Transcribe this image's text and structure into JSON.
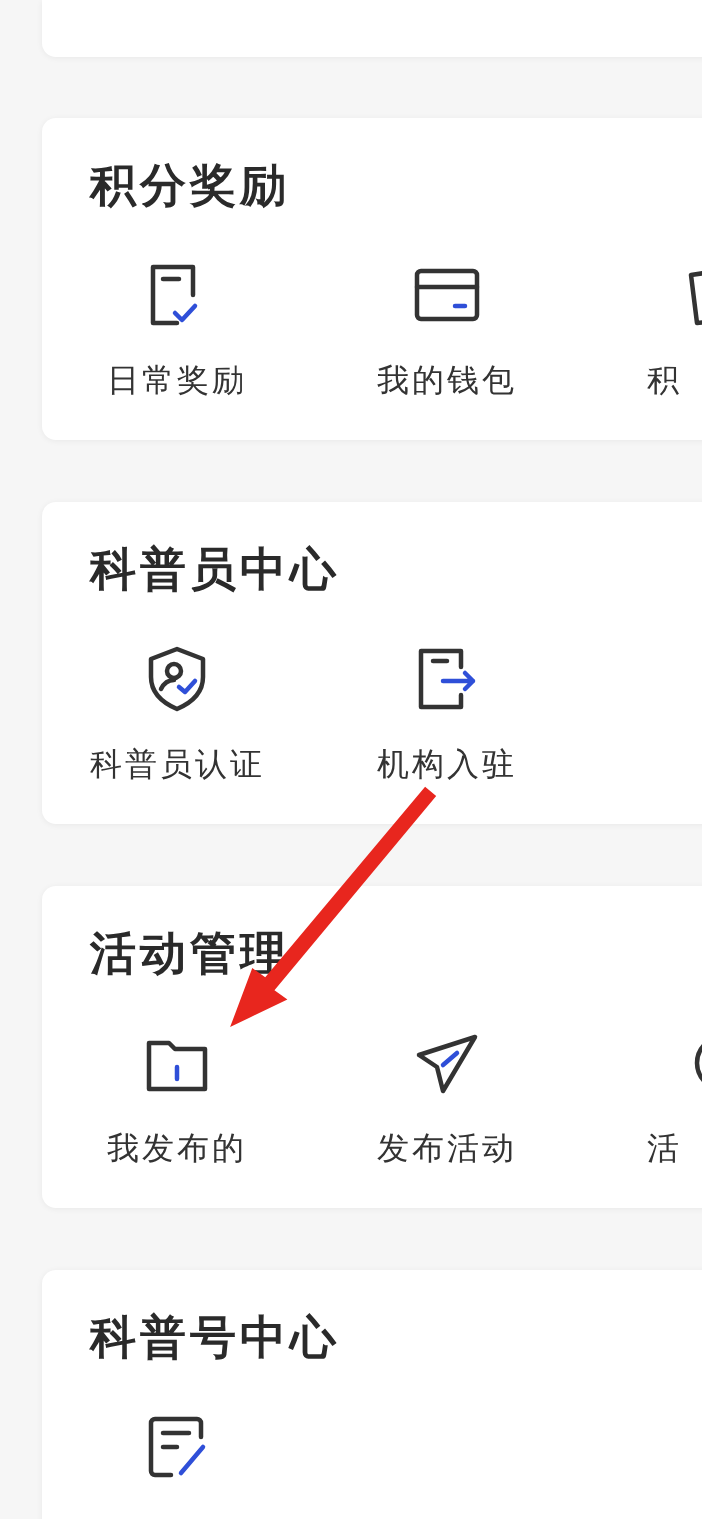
{
  "sections": [
    {
      "title": "积分奖励",
      "items": [
        {
          "kind": "checklist",
          "label": "日常奖励"
        },
        {
          "kind": "wallet",
          "label": "我的钱包"
        },
        {
          "kind": "bag",
          "label": "积"
        }
      ]
    },
    {
      "title": "科普员中心",
      "items": [
        {
          "kind": "shield",
          "label": "科普员认证"
        },
        {
          "kind": "enter",
          "label": "机构入驻"
        }
      ]
    },
    {
      "title": "活动管理",
      "items": [
        {
          "kind": "folder",
          "label": "我发布的"
        },
        {
          "kind": "plane",
          "label": "发布活动"
        },
        {
          "kind": "circle",
          "label": "活"
        }
      ]
    },
    {
      "title": "科普号中心",
      "items": [
        {
          "kind": "edit"
        }
      ]
    }
  ],
  "annotation": {
    "kind": "arrow"
  }
}
